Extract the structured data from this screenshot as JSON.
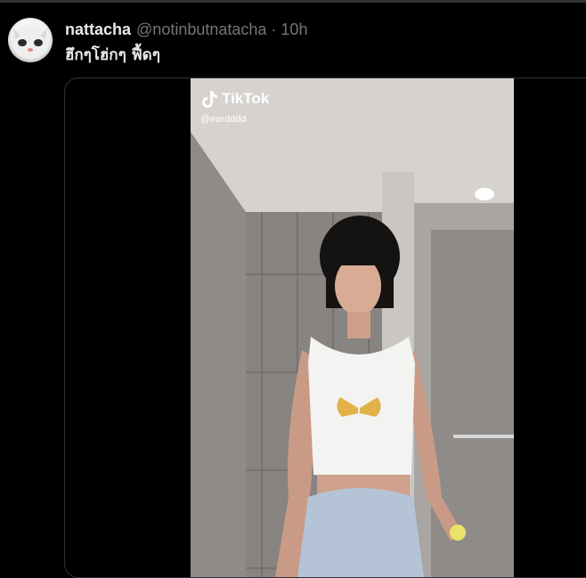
{
  "tweet": {
    "display_name": "nattacha",
    "handle": "@notinbutnatacha",
    "separator": "·",
    "time": "10h",
    "text": "ฮึกๆโฮ่กๆ ฟี้ดๆ"
  },
  "video": {
    "watermark": "TikTok",
    "creator_handle": "@eardddd"
  },
  "icons": {
    "avatar": "cat-avatar",
    "watermark_icon": "tiktok-note-icon"
  }
}
